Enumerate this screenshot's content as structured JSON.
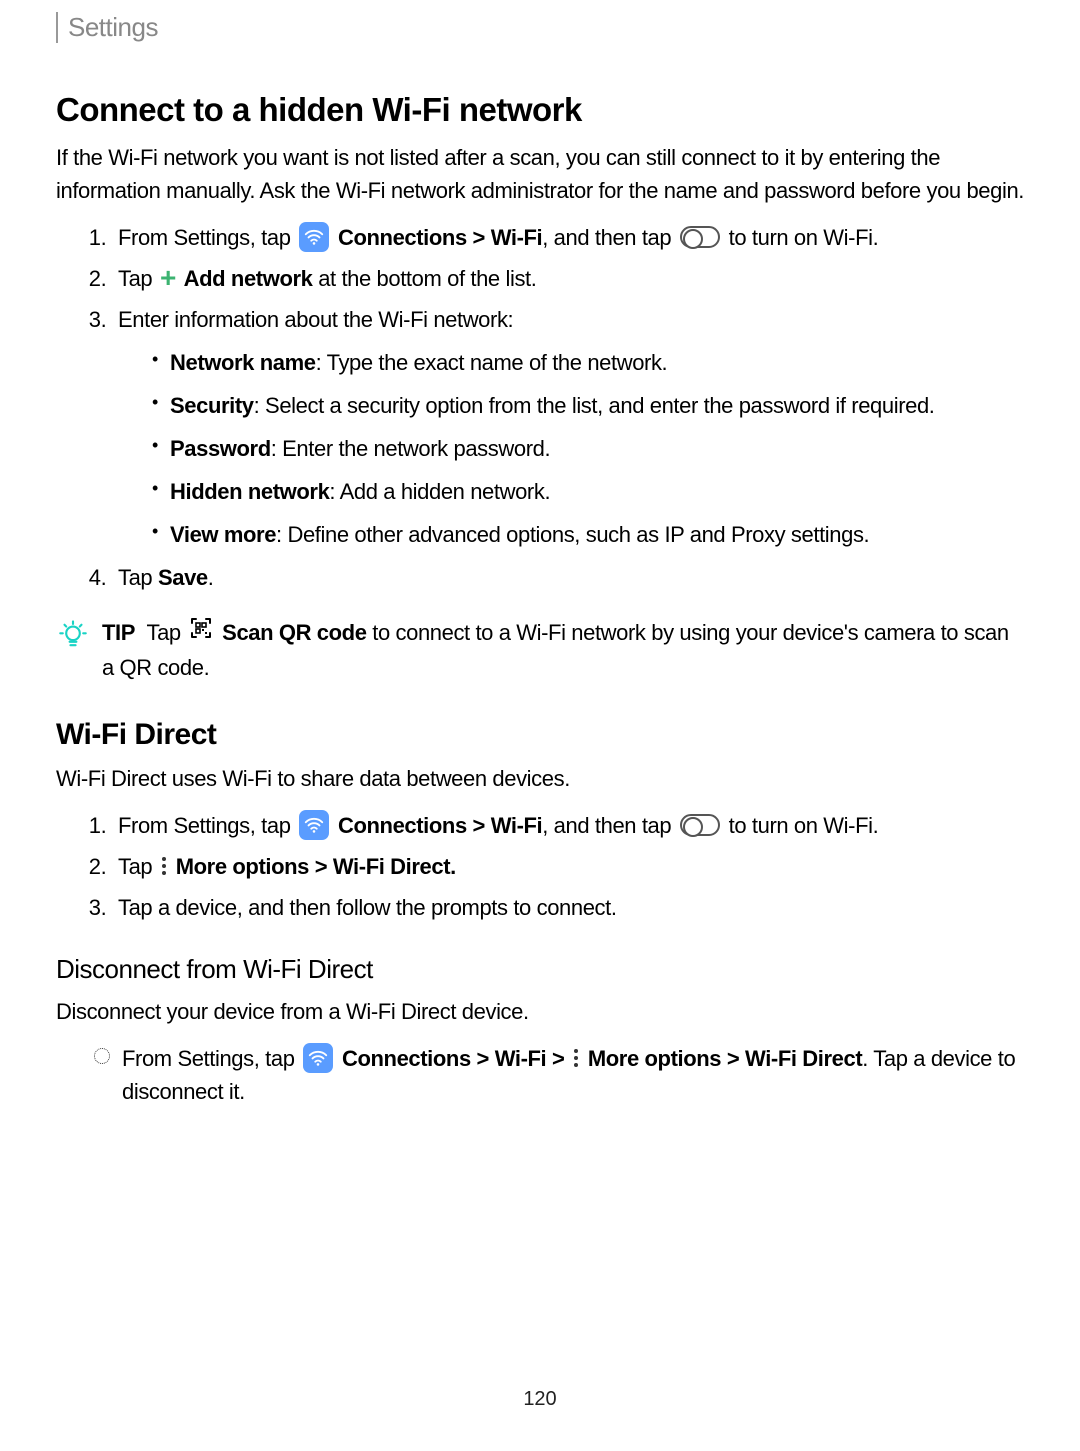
{
  "breadcrumb": "Settings",
  "section1": {
    "title": "Connect to a hidden Wi-Fi network",
    "intro": "If the Wi-Fi network you want is not listed after a scan, you can still connect to it by entering the information manually. Ask the Wi-Fi network administrator for the name and password before you begin.",
    "step1_a": "From Settings, tap ",
    "step1_connections": "Connections",
    "step1_gt1": " > ",
    "step1_wifi": "Wi-Fi",
    "step1_b": ", and then tap ",
    "step1_c": " to turn on Wi-Fi.",
    "step2_a": "Tap ",
    "step2_add": "Add network",
    "step2_b": " at the bottom of the list.",
    "step3": "Enter information about the Wi-Fi network:",
    "bullets": {
      "b1_label": "Network name",
      "b1_text": ": Type the exact name of the network.",
      "b2_label": "Security",
      "b2_text": ": Select a security option from the list, and enter the password if required.",
      "b3_label": "Password",
      "b3_text": ": Enter the network password.",
      "b4_label": "Hidden network",
      "b4_text": ": Add a hidden network.",
      "b5_label": "View more",
      "b5_text": ": Define other advanced options, such as IP and Proxy settings."
    },
    "step4_a": "Tap ",
    "step4_save": "Save",
    "step4_b": ".",
    "tip_label": "TIP",
    "tip_a": "Tap ",
    "tip_scan": "Scan QR code",
    "tip_b": " to connect to a Wi-Fi network by using your device's camera to scan a QR code."
  },
  "section2": {
    "title": "Wi-Fi Direct",
    "intro": "Wi-Fi Direct uses Wi-Fi to share data between devices.",
    "step1_a": "From Settings, tap ",
    "step1_connections": "Connections",
    "step1_gt1": " > ",
    "step1_wifi": "Wi-Fi",
    "step1_b": ", and then tap ",
    "step1_c": " to turn on Wi-Fi.",
    "step2_a": "Tap ",
    "step2_more": "More options",
    "step2_gt": " > ",
    "step2_wfd": "Wi-Fi Direct",
    "step2_b": ".",
    "step3": "Tap a device, and then follow the prompts to connect."
  },
  "section3": {
    "title": "Disconnect from Wi-Fi Direct",
    "intro": "Disconnect your device from a Wi-Fi Direct device.",
    "item_a": "From Settings, tap ",
    "item_connections": "Connections",
    "item_gt1": " > ",
    "item_wifi": "Wi-Fi",
    "item_gt2": " > ",
    "item_more": "More options",
    "item_gt3": " > ",
    "item_wfd": "Wi-Fi Direct",
    "item_b": ". Tap a device to disconnect it."
  },
  "page_number": "120"
}
